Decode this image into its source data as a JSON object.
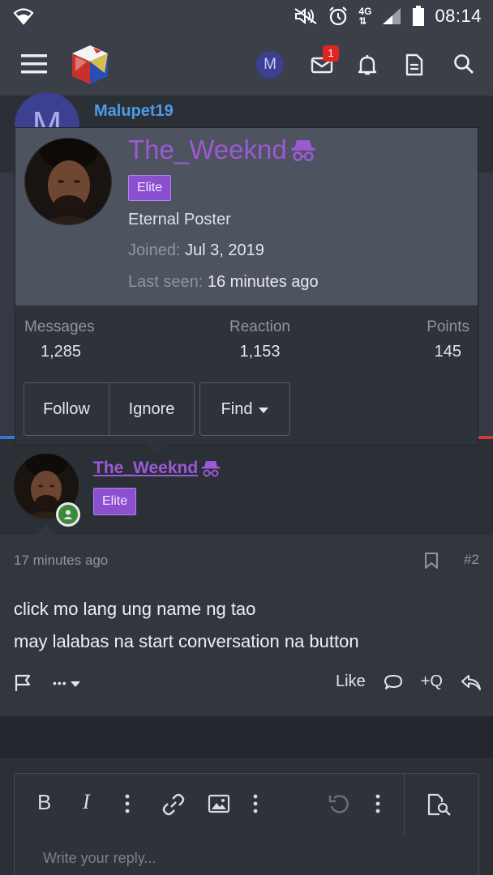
{
  "status_bar": {
    "network_label": "4G",
    "time": "08:14"
  },
  "header": {
    "user_initial": "M",
    "inbox_badge": "1",
    "icons": [
      "menu-icon",
      "site-logo",
      "inbox-icon",
      "bell-icon",
      "document-icon",
      "search-icon"
    ]
  },
  "background": {
    "author_initial": "M",
    "author_name": "Malupet19"
  },
  "member_card": {
    "username": "The_Weeknd",
    "rank_badge": "Elite",
    "user_title": "Eternal Poster",
    "joined_label": "Joined:",
    "joined_value": "Jul 3, 2019",
    "last_seen_label": "Last seen:",
    "last_seen_value": "16 minutes ago",
    "stats": [
      {
        "label": "Messages",
        "value": "1,285"
      },
      {
        "label": "Reaction",
        "value": "1,153"
      },
      {
        "label": "Points",
        "value": "145"
      }
    ],
    "actions": {
      "follow": "Follow",
      "ignore": "Ignore",
      "find": "Find"
    }
  },
  "post": {
    "author": "The_Weeknd",
    "rank_badge": "Elite",
    "time": "17 minutes ago",
    "post_number": "#2",
    "lines": [
      "click mo lang ung name ng tao",
      "may lalabas na start conversation na button"
    ],
    "actions": {
      "more": "•••",
      "like": "Like",
      "quote": "+Q"
    }
  },
  "editor": {
    "bold": "B",
    "italic": "I",
    "placeholder": "Write your reply..."
  },
  "colors": {
    "header_bg": "#3a3f48",
    "card_top": "#4d535f",
    "username": "#9b59d6",
    "elite_badge": "#8c4fd0",
    "author_link": "#4d9be6",
    "online": "#3b8b3a",
    "badge_red": "#e02424"
  }
}
